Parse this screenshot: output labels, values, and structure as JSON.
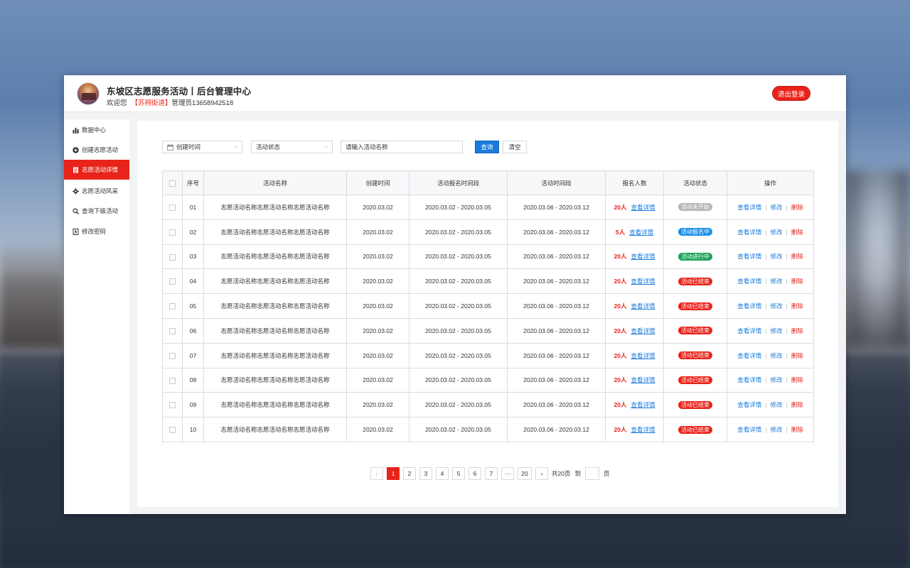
{
  "header": {
    "title": "东坡区志愿服务活动丨后台管理中心",
    "welcome_prefix": "欢迎您",
    "street": "【苏祠街道】",
    "admin": "管理员13658942518",
    "logout_label": "退出登录"
  },
  "sidebar": {
    "items": [
      {
        "label": "数据中心",
        "icon": "bar-chart-icon"
      },
      {
        "label": "创建志愿活动",
        "icon": "plus-circle-icon"
      },
      {
        "label": "志愿活动详情",
        "icon": "document-icon"
      },
      {
        "label": "志愿活动风采",
        "icon": "gear-icon"
      },
      {
        "label": "查询下级活动",
        "icon": "search-icon"
      },
      {
        "label": "修改密码",
        "icon": "lock-icon"
      }
    ],
    "active_index": 2
  },
  "filters": {
    "created_time": "创建时间",
    "status": "活动状态",
    "name_placeholder": "请输入活动名称",
    "query_label": "查询",
    "clear_label": "清空"
  },
  "table": {
    "headers": [
      "序号",
      "活动名称",
      "创建时间",
      "活动报名时间段",
      "活动时间段",
      "报名人数",
      "活动状态",
      "操作"
    ],
    "view_label": "查看详情",
    "edit_label": "修改",
    "delete_label": "删除",
    "rows": [
      {
        "no": "01",
        "name": "志愿活动名称志愿活动名称志愿活动名称",
        "created": "2020.03.02",
        "signup": "2020.03.02 - 2020.03.05",
        "period": "2020.03.06 - 2020.03.12",
        "count": "20人",
        "status": "活动未开始",
        "status_color": "#b5b5b5"
      },
      {
        "no": "02",
        "name": "志愿活动名称志愿活动名称志愿活动名称",
        "created": "2020.03.02",
        "signup": "2020.03.02 - 2020.03.05",
        "period": "2020.03.06 - 2020.03.12",
        "count": "5人",
        "status": "活动报名中",
        "status_color": "#1a8fe8"
      },
      {
        "no": "03",
        "name": "志愿活动名称志愿活动名称志愿活动名称",
        "created": "2020.03.02",
        "signup": "2020.03.02 - 2020.03.05",
        "period": "2020.03.06 - 2020.03.12",
        "count": "20人",
        "status": "活动进行中",
        "status_color": "#1aa05a"
      },
      {
        "no": "04",
        "name": "志愿活动名称志愿活动名称志愿活动名称",
        "created": "2020.03.02",
        "signup": "2020.03.02 - 2020.03.05",
        "period": "2020.03.06 - 2020.03.12",
        "count": "20人",
        "status": "活动已结束",
        "status_color": "#e8231a"
      },
      {
        "no": "05",
        "name": "志愿活动名称志愿活动名称志愿活动名称",
        "created": "2020.03.02",
        "signup": "2020.03.02 - 2020.03.05",
        "period": "2020.03.06 - 2020.03.12",
        "count": "20人",
        "status": "活动已结束",
        "status_color": "#e8231a"
      },
      {
        "no": "06",
        "name": "志愿活动名称志愿活动名称志愿活动名称",
        "created": "2020.03.02",
        "signup": "2020.03.02 - 2020.03.05",
        "period": "2020.03.06 - 2020.03.12",
        "count": "20人",
        "status": "活动已结束",
        "status_color": "#e8231a"
      },
      {
        "no": "07",
        "name": "志愿活动名称志愿活动名称志愿活动名称",
        "created": "2020.03.02",
        "signup": "2020.03.02 - 2020.03.05",
        "period": "2020.03.06 - 2020.03.12",
        "count": "20人",
        "status": "活动已结束",
        "status_color": "#e8231a"
      },
      {
        "no": "08",
        "name": "志愿活动名称志愿活动名称志愿活动名称",
        "created": "2020.03.02",
        "signup": "2020.03.02 - 2020.03.05",
        "period": "2020.03.06 - 2020.03.12",
        "count": "20人",
        "status": "活动已结束",
        "status_color": "#e8231a"
      },
      {
        "no": "09",
        "name": "志愿活动名称志愿活动名称志愿活动名称",
        "created": "2020.03.02",
        "signup": "2020.03.02 - 2020.03.05",
        "period": "2020.03.06 - 2020.03.12",
        "count": "20人",
        "status": "活动已结束",
        "status_color": "#e8231a"
      },
      {
        "no": "10",
        "name": "志愿活动名称志愿活动名称志愿活动名称",
        "created": "2020.03.02",
        "signup": "2020.03.02 - 2020.03.05",
        "period": "2020.03.06 - 2020.03.12",
        "count": "20人",
        "status": "活动已结束",
        "status_color": "#e8231a"
      }
    ]
  },
  "pagination": {
    "prev": "‹",
    "next": "›",
    "pages": [
      "1",
      "2",
      "3",
      "4",
      "5",
      "6",
      "7",
      "···",
      "20"
    ],
    "active_index": 0,
    "total": "共20页",
    "goto": "到",
    "unit": "页"
  },
  "colors": {
    "brand_red": "#e8231a",
    "link_blue": "#1a7bdb"
  }
}
